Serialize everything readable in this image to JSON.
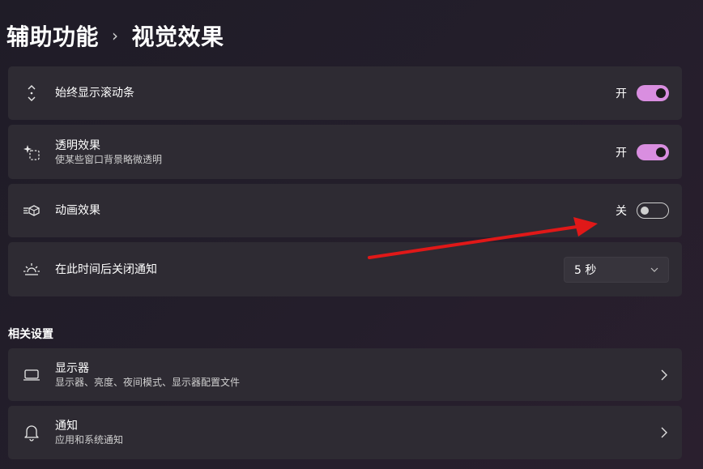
{
  "breadcrumb": {
    "parent": "辅助功能",
    "separator": "›",
    "current": "视觉效果"
  },
  "settings": [
    {
      "icon": "scrollbar-icon",
      "title": "始终显示滚动条",
      "subtitle": "",
      "control": "toggle",
      "state_label": "开",
      "on": true
    },
    {
      "icon": "transparency-icon",
      "title": "透明效果",
      "subtitle": "使某些窗口背景略微透明",
      "control": "toggle",
      "state_label": "开",
      "on": true
    },
    {
      "icon": "animation-icon",
      "title": "动画效果",
      "subtitle": "",
      "control": "toggle",
      "state_label": "关",
      "on": false
    },
    {
      "icon": "brightness-icon",
      "title": "在此时间后关闭通知",
      "subtitle": "",
      "control": "dropdown",
      "selected": "5 秒"
    }
  ],
  "related": {
    "title": "相关设置",
    "items": [
      {
        "icon": "display-icon",
        "title": "显示器",
        "subtitle": "显示器、亮度、夜间模式、显示器配置文件"
      },
      {
        "icon": "bell-icon",
        "title": "通知",
        "subtitle": "应用和系统通知"
      }
    ]
  },
  "colors": {
    "toggle_on": "#d98ee0",
    "card_bg": "#2e2b33",
    "annotation_arrow": "#e01818"
  }
}
